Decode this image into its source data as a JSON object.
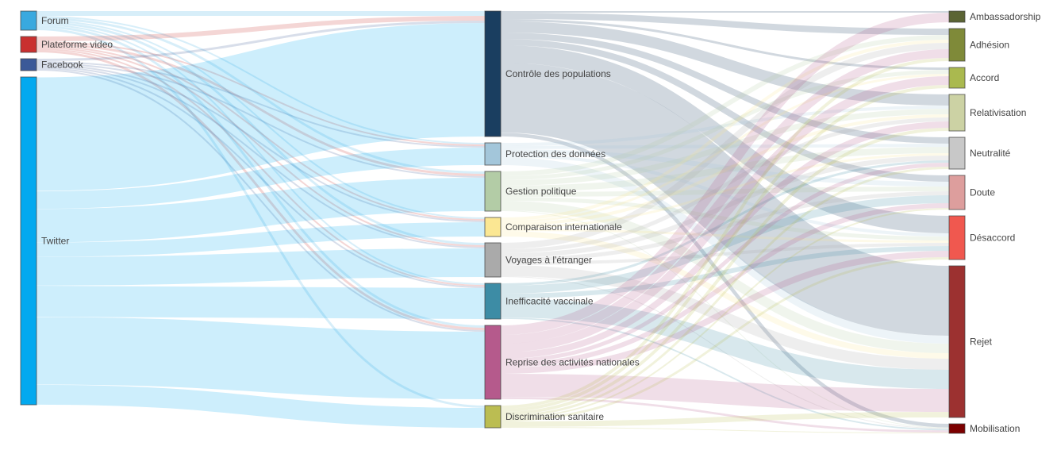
{
  "chart_data": {
    "type": "sankey",
    "title": "",
    "columns": [
      {
        "level": "source",
        "nodes": [
          {
            "id": "forum",
            "label": "Forum",
            "color": "#39a9df",
            "value": 24
          },
          {
            "id": "plateforme",
            "label": "Plateforme video",
            "color": "#c9302f",
            "value": 20
          },
          {
            "id": "facebook",
            "label": "Facebook",
            "color": "#3b5998",
            "value": 15
          },
          {
            "id": "twitter",
            "label": "Twitter",
            "color": "#03a9ef",
            "value": 413
          }
        ]
      },
      {
        "level": "theme",
        "nodes": [
          {
            "id": "controle",
            "label": "Contrôle des populations",
            "color": "#1a3e60",
            "value": 158
          },
          {
            "id": "protection",
            "label": "Protection des données",
            "color": "#a3c6da",
            "value": 28
          },
          {
            "id": "gestion",
            "label": "Gestion politique",
            "color": "#b3cca6",
            "value": 50
          },
          {
            "id": "comparaison",
            "label": "Comparaison internationale",
            "color": "#fbe793",
            "value": 24
          },
          {
            "id": "voyages",
            "label": "Voyages à l'étranger",
            "color": "#aaaaaa",
            "value": 43
          },
          {
            "id": "inefficacite",
            "label": "Inefficacité vaccinale",
            "color": "#3d8ca5",
            "value": 45
          },
          {
            "id": "reprise",
            "label": "Reprise des activités nationales",
            "color": "#b55a8c",
            "value": 93
          },
          {
            "id": "discrimination",
            "label": "Discrimination sanitaire",
            "color": "#bbbd52",
            "value": 28
          }
        ]
      },
      {
        "level": "stance",
        "nodes": [
          {
            "id": "ambassadorship",
            "label": "Ambassadorship",
            "color": "#5b6434",
            "value": 14
          },
          {
            "id": "adhesion",
            "label": "Adhésion",
            "color": "#7f8a39",
            "value": 41
          },
          {
            "id": "accord",
            "label": "Accord",
            "color": "#aab94f",
            "value": 26
          },
          {
            "id": "relativisation",
            "label": "Relativisation",
            "color": "#ccd2a4",
            "value": 46
          },
          {
            "id": "neutralite",
            "label": "Neutralité",
            "color": "#c8c8c8",
            "value": 40
          },
          {
            "id": "doute",
            "label": "Doute",
            "color": "#dd9e9d",
            "value": 43
          },
          {
            "id": "desaccord",
            "label": "Désaccord",
            "color": "#f0584f",
            "value": 55
          },
          {
            "id": "rejet",
            "label": "Rejet",
            "color": "#9c3130",
            "value": 191
          },
          {
            "id": "mobilisation",
            "label": "Mobilisation",
            "color": "#7c0000",
            "value": 12
          }
        ]
      }
    ],
    "links": [
      {
        "source": "forum",
        "target": "controle",
        "value": 6
      },
      {
        "source": "forum",
        "target": "protection",
        "value": 2
      },
      {
        "source": "forum",
        "target": "gestion",
        "value": 3
      },
      {
        "source": "forum",
        "target": "comparaison",
        "value": 2
      },
      {
        "source": "forum",
        "target": "voyages",
        "value": 3
      },
      {
        "source": "forum",
        "target": "inefficacite",
        "value": 2
      },
      {
        "source": "forum",
        "target": "reprise",
        "value": 3
      },
      {
        "source": "forum",
        "target": "discrimination",
        "value": 3
      },
      {
        "source": "plateforme",
        "target": "controle",
        "value": 6
      },
      {
        "source": "plateforme",
        "target": "protection",
        "value": 2
      },
      {
        "source": "plateforme",
        "target": "gestion",
        "value": 3
      },
      {
        "source": "plateforme",
        "target": "comparaison",
        "value": 2
      },
      {
        "source": "plateforme",
        "target": "voyages",
        "value": 2
      },
      {
        "source": "plateforme",
        "target": "inefficacite",
        "value": 2
      },
      {
        "source": "plateforme",
        "target": "reprise",
        "value": 3
      },
      {
        "source": "facebook",
        "target": "controle",
        "value": 3
      },
      {
        "source": "facebook",
        "target": "protection",
        "value": 2
      },
      {
        "source": "facebook",
        "target": "gestion",
        "value": 2
      },
      {
        "source": "facebook",
        "target": "comparaison",
        "value": 2
      },
      {
        "source": "facebook",
        "target": "voyages",
        "value": 2
      },
      {
        "source": "facebook",
        "target": "inefficacite",
        "value": 2
      },
      {
        "source": "facebook",
        "target": "reprise",
        "value": 2
      },
      {
        "source": "twitter",
        "target": "controle",
        "value": 143
      },
      {
        "source": "twitter",
        "target": "protection",
        "value": 22
      },
      {
        "source": "twitter",
        "target": "gestion",
        "value": 42
      },
      {
        "source": "twitter",
        "target": "comparaison",
        "value": 18
      },
      {
        "source": "twitter",
        "target": "voyages",
        "value": 36
      },
      {
        "source": "twitter",
        "target": "inefficacite",
        "value": 39
      },
      {
        "source": "twitter",
        "target": "reprise",
        "value": 85
      },
      {
        "source": "twitter",
        "target": "discrimination",
        "value": 25
      },
      {
        "source": "controle",
        "target": "ambassadorship",
        "value": 2
      },
      {
        "source": "controle",
        "target": "adhesion",
        "value": 8
      },
      {
        "source": "controle",
        "target": "accord",
        "value": 3
      },
      {
        "source": "controle",
        "target": "relativisation",
        "value": 14
      },
      {
        "source": "controle",
        "target": "neutralite",
        "value": 8
      },
      {
        "source": "controle",
        "target": "doute",
        "value": 8
      },
      {
        "source": "controle",
        "target": "desaccord",
        "value": 22
      },
      {
        "source": "controle",
        "target": "rejet",
        "value": 88
      },
      {
        "source": "controle",
        "target": "mobilisation",
        "value": 5
      },
      {
        "source": "protection",
        "target": "relativisation",
        "value": 4
      },
      {
        "source": "protection",
        "target": "neutralite",
        "value": 4
      },
      {
        "source": "protection",
        "target": "doute",
        "value": 6
      },
      {
        "source": "protection",
        "target": "desaccord",
        "value": 4
      },
      {
        "source": "protection",
        "target": "rejet",
        "value": 10
      },
      {
        "source": "gestion",
        "target": "adhesion",
        "value": 6
      },
      {
        "source": "gestion",
        "target": "accord",
        "value": 5
      },
      {
        "source": "gestion",
        "target": "relativisation",
        "value": 7
      },
      {
        "source": "gestion",
        "target": "neutralite",
        "value": 8
      },
      {
        "source": "gestion",
        "target": "doute",
        "value": 6
      },
      {
        "source": "gestion",
        "target": "desaccord",
        "value": 5
      },
      {
        "source": "gestion",
        "target": "rejet",
        "value": 12
      },
      {
        "source": "gestion",
        "target": "mobilisation",
        "value": 1
      },
      {
        "source": "comparaison",
        "target": "adhesion",
        "value": 4
      },
      {
        "source": "comparaison",
        "target": "accord",
        "value": 3
      },
      {
        "source": "comparaison",
        "target": "relativisation",
        "value": 4
      },
      {
        "source": "comparaison",
        "target": "neutralite",
        "value": 3
      },
      {
        "source": "comparaison",
        "target": "desaccord",
        "value": 3
      },
      {
        "source": "comparaison",
        "target": "rejet",
        "value": 7
      },
      {
        "source": "voyages",
        "target": "adhesion",
        "value": 8
      },
      {
        "source": "voyages",
        "target": "relativisation",
        "value": 5
      },
      {
        "source": "voyages",
        "target": "neutralite",
        "value": 6
      },
      {
        "source": "voyages",
        "target": "doute",
        "value": 5
      },
      {
        "source": "voyages",
        "target": "desaccord",
        "value": 4
      },
      {
        "source": "voyages",
        "target": "rejet",
        "value": 14
      },
      {
        "source": "voyages",
        "target": "mobilisation",
        "value": 1
      },
      {
        "source": "inefficacite",
        "target": "neutralite",
        "value": 3
      },
      {
        "source": "inefficacite",
        "target": "doute",
        "value": 10
      },
      {
        "source": "inefficacite",
        "target": "desaccord",
        "value": 6
      },
      {
        "source": "inefficacite",
        "target": "rejet",
        "value": 24
      },
      {
        "source": "inefficacite",
        "target": "mobilisation",
        "value": 2
      },
      {
        "source": "reprise",
        "target": "ambassadorship",
        "value": 12
      },
      {
        "source": "reprise",
        "target": "adhesion",
        "value": 11
      },
      {
        "source": "reprise",
        "target": "accord",
        "value": 11
      },
      {
        "source": "reprise",
        "target": "relativisation",
        "value": 8
      },
      {
        "source": "reprise",
        "target": "neutralite",
        "value": 5
      },
      {
        "source": "reprise",
        "target": "doute",
        "value": 6
      },
      {
        "source": "reprise",
        "target": "desaccord",
        "value": 8
      },
      {
        "source": "reprise",
        "target": "rejet",
        "value": 29
      },
      {
        "source": "reprise",
        "target": "mobilisation",
        "value": 3
      },
      {
        "source": "discrimination",
        "target": "adhesion",
        "value": 4
      },
      {
        "source": "discrimination",
        "target": "accord",
        "value": 4
      },
      {
        "source": "discrimination",
        "target": "relativisation",
        "value": 4
      },
      {
        "source": "discrimination",
        "target": "neutralite",
        "value": 3
      },
      {
        "source": "discrimination",
        "target": "doute",
        "value": 2
      },
      {
        "source": "discrimination",
        "target": "desaccord",
        "value": 3
      },
      {
        "source": "discrimination",
        "target": "rejet",
        "value": 7
      },
      {
        "source": "discrimination",
        "target": "mobilisation",
        "value": 1
      }
    ]
  }
}
